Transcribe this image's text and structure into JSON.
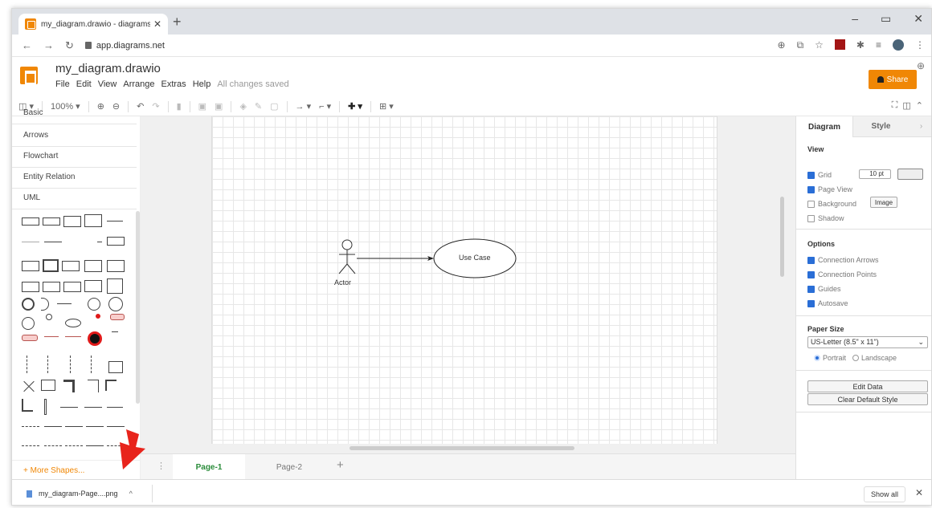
{
  "browser": {
    "tab_title": "my_diagram.drawio - diagrams.n",
    "new_tab": "+",
    "url": "app.diagrams.net"
  },
  "app": {
    "file_name": "my_diagram.drawio",
    "menus": [
      "File",
      "Edit",
      "View",
      "Arrange",
      "Extras",
      "Help"
    ],
    "save_status": "All changes saved",
    "share_label": "Share"
  },
  "toolbar": {
    "zoom": "100%"
  },
  "sidebar": {
    "categories": [
      "Basic",
      "Arrows",
      "Flowchart",
      "Entity Relation",
      "UML"
    ],
    "more_shapes": "+ More Shapes..."
  },
  "diagram": {
    "actor_label": "Actor",
    "usecase_label": "Use Case"
  },
  "pages": {
    "tabs": [
      "Page-1",
      "Page-2"
    ],
    "active": "Page-1",
    "add": "+"
  },
  "format_panel": {
    "tabs": [
      "Diagram",
      "Style"
    ],
    "view_title": "View",
    "grid_label": "Grid",
    "grid_size": "10 pt",
    "page_view_label": "Page View",
    "background_label": "Background",
    "image_button": "Image",
    "shadow_label": "Shadow",
    "options_title": "Options",
    "connection_arrows": "Connection Arrows",
    "connection_points": "Connection Points",
    "guides": "Guides",
    "autosave": "Autosave",
    "paper_size_title": "Paper Size",
    "paper_size_value": "US-Letter (8.5\" x 11\")",
    "portrait": "Portrait",
    "landscape": "Landscape",
    "edit_data": "Edit Data",
    "clear_default_style": "Clear Default Style"
  },
  "downloads": {
    "file_name": "my_diagram-Page....png",
    "show_all": "Show all"
  },
  "colors": {
    "accent": "#f08705",
    "active_page": "#2a8c3a",
    "checkbox": "#2a6ed6",
    "annotation_arrow": "#e8241c"
  }
}
